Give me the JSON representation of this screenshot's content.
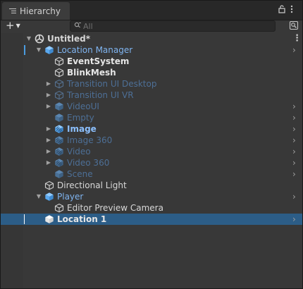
{
  "tab": {
    "label": "Hierarchy",
    "lock_icon": "lock-icon",
    "menu_icon": "kebab-icon"
  },
  "toolbar": {
    "add_label": "+",
    "search_placeholder": "All",
    "search_value": ""
  },
  "colors": {
    "selection": "#2c5d87",
    "prefab_text": "#7fb4f0",
    "inactive_text": "#4d6f96",
    "panel": "#383838"
  },
  "rows": [
    {
      "label": "Untitled*",
      "depth": 0,
      "icon": "unity-scene-icon",
      "arrow": "expanded",
      "style": "scene",
      "trail": "more"
    },
    {
      "label": "Location Manager",
      "depth": 1,
      "icon": "prefab-icon",
      "arrow": "expanded",
      "style": "prefab",
      "trail": "chevron",
      "marker": true
    },
    {
      "label": "EventSystem",
      "depth": 2,
      "icon": "gameobject-icon",
      "arrow": "none",
      "style": "white-b",
      "trail": ""
    },
    {
      "label": "BlinkMesh",
      "depth": 2,
      "icon": "gameobject-icon",
      "arrow": "none",
      "style": "white-b",
      "trail": ""
    },
    {
      "label": "Transition UI Desktop",
      "depth": 2,
      "icon": "gameobject-icon-inactive",
      "arrow": "collapsed",
      "style": "inactive",
      "trail": ""
    },
    {
      "label": "Transition UI VR",
      "depth": 2,
      "icon": "gameobject-icon-inactive",
      "arrow": "collapsed",
      "style": "inactive",
      "trail": ""
    },
    {
      "label": "VideoUI",
      "depth": 2,
      "icon": "prefab-icon-inactive",
      "arrow": "collapsed",
      "style": "inactive",
      "trail": "chevron"
    },
    {
      "label": "Empty",
      "depth": 2,
      "icon": "prefab-icon-inactive",
      "arrow": "none",
      "style": "inactive",
      "trail": "chevron"
    },
    {
      "label": "Image",
      "depth": 2,
      "icon": "prefab-variant-icon",
      "arrow": "collapsed",
      "style": "prefab-b",
      "trail": "chevron"
    },
    {
      "label": "Image 360",
      "depth": 2,
      "icon": "prefab-variant-icon-inactive",
      "arrow": "collapsed",
      "style": "inactive",
      "trail": "chevron"
    },
    {
      "label": "Video",
      "depth": 2,
      "icon": "prefab-variant-icon-inactive",
      "arrow": "collapsed",
      "style": "inactive",
      "trail": "chevron"
    },
    {
      "label": "Video 360",
      "depth": 2,
      "icon": "prefab-variant-icon-inactive",
      "arrow": "collapsed",
      "style": "inactive",
      "trail": "chevron"
    },
    {
      "label": "Scene",
      "depth": 2,
      "icon": "prefab-icon-inactive",
      "arrow": "none",
      "style": "inactive",
      "trail": "chevron"
    },
    {
      "label": "Directional Light",
      "depth": 1,
      "icon": "gameobject-icon",
      "arrow": "none",
      "style": "white",
      "trail": ""
    },
    {
      "label": "Player",
      "depth": 1,
      "icon": "prefab-icon",
      "arrow": "expanded",
      "style": "prefab",
      "trail": "chevron"
    },
    {
      "label": "Editor Preview Camera",
      "depth": 2,
      "icon": "gameobject-icon",
      "arrow": "none",
      "style": "white",
      "trail": ""
    },
    {
      "label": "Location 1",
      "depth": 1,
      "icon": "prefab-icon-white",
      "arrow": "none",
      "style": "white-b",
      "trail": "chevron",
      "selected": true,
      "cursor": true
    }
  ]
}
